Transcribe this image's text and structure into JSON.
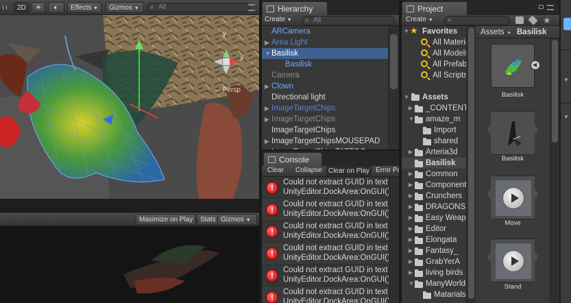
{
  "scene_toolbar": {
    "twod_label": "2D",
    "effects_label": "Effects",
    "gizmos_label": "Gizmos",
    "search_placeholder": "All",
    "persp_label": "← Persp",
    "axis_y": "y",
    "axis_x": "x"
  },
  "game_toolbar": {
    "maximize_label": "Maximize on Play",
    "stats_label": "Stats",
    "gizmos_label": "Gizmos"
  },
  "hierarchy": {
    "tab_label": "Hierarchy",
    "create_label": "Create",
    "search_placeholder": "All",
    "items": [
      {
        "label": "ARCamera",
        "color": "#6fa8ff"
      },
      {
        "label": "Area Light",
        "color": "#5b84c8"
      },
      {
        "label": "Basilisk",
        "color": "#ffffff"
      },
      {
        "label": "Basilisk",
        "color": "#6fa8ff"
      },
      {
        "label": "Camera",
        "color": "#8c8c8c"
      },
      {
        "label": "Clown",
        "color": "#6fa8ff"
      },
      {
        "label": "Directional light",
        "color": "#d8d8d8"
      },
      {
        "label": "ImageTargetChips",
        "color": "#5b84c8"
      },
      {
        "label": "ImageTargetChips",
        "color": "#8c8c8c"
      },
      {
        "label": "ImageTargetChips",
        "color": "#d8d8d8"
      },
      {
        "label": "ImageTargetChipsMOUSEPAD",
        "color": "#d8d8d8"
      },
      {
        "label": "ImageTargetChipsTATTOO",
        "color": "#d8d8d8"
      }
    ]
  },
  "console": {
    "tab_label": "Console",
    "clear_label": "Clear",
    "collapse_label": "Collapse",
    "clear_on_play_label": "Clear on Play",
    "error_pause_label": "Error Pause",
    "messages": [
      {
        "line1": "Could not extract GUID in text",
        "line2": "UnityEditor.DockArea:OnGUI()"
      },
      {
        "line1": "Could not extract GUID in text",
        "line2": "UnityEditor.DockArea:OnGUI()"
      },
      {
        "line1": "Could not extract GUID in text",
        "line2": "UnityEditor.DockArea:OnGUI()"
      },
      {
        "line1": "Could not extract GUID in text",
        "line2": "UnityEditor.DockArea:OnGUI()"
      },
      {
        "line1": "Could not extract GUID in text",
        "line2": "UnityEditor.DockArea:OnGUI()"
      },
      {
        "line1": "Could not extract GUID in text",
        "line2": "UnityEditor.DockArea:OnGUI()"
      }
    ]
  },
  "project": {
    "tab_label": "Project",
    "create_label": "Create",
    "favorites_label": "Favorites",
    "favorites": [
      "All Materials",
      "All Models",
      "All Prefabs",
      "All Scripts"
    ],
    "assets_label": "Assets",
    "folders": [
      "_CONTENT",
      "amaze_m",
      "Import",
      "shared",
      "Arteria3d",
      "Basilisk",
      "Common",
      "Components",
      "Crunchers",
      "DRAGONS",
      "Easy Weapons",
      "Editor",
      "Elongata",
      "Fantasy_",
      "GrabYerA",
      "living birds",
      "ManyWorlds",
      "Matarials"
    ],
    "breadcrumb_root": "Assets",
    "breadcrumb_sep": "▸",
    "breadcrumb_current": "Basilisk",
    "assets": [
      "Basilisk",
      "Basilisk",
      "Move",
      "Stand"
    ]
  },
  "colors": {
    "selection": "#3d6090",
    "link_blue": "#6fa8ff",
    "error_red": "#d01010"
  }
}
